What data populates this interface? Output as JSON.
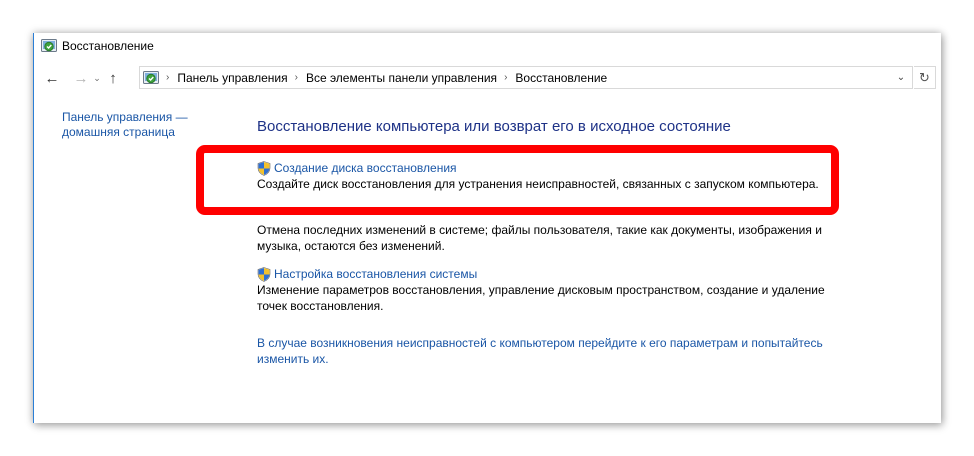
{
  "window": {
    "title": "Восстановление"
  },
  "nav": {
    "back_icon": "←",
    "forward_icon": "→",
    "history_icon": "⌄",
    "up_icon": "↑",
    "refresh_icon": "↻",
    "dropdown_icon": "⌄"
  },
  "breadcrumbs": [
    {
      "label": "Панель управления"
    },
    {
      "label": "Все элементы панели управления"
    },
    {
      "label": "Восстановление"
    }
  ],
  "breadcrumb_separator": "›",
  "sidebar": {
    "home_link_line1": "Панель управления —",
    "home_link_line2": "домашняя страница"
  },
  "main": {
    "heading": "Восстановление компьютера или возврат его в исходное состояние",
    "tasks": [
      {
        "link": "Создание диска восстановления",
        "description": "Создайте диск восстановления для устранения неисправностей, связанных с запуском компьютера.",
        "icon": "shield-icon"
      },
      {
        "link": "",
        "description": "Отмена последних изменений в системе; файлы пользователя, такие как документы, изображения и музыка, остаются без изменений."
      },
      {
        "link": "Настройка восстановления системы",
        "description": "Изменение параметров восстановления, управление дисковым пространством, создание и удаление точек восстановления.",
        "icon": "shield-icon"
      }
    ],
    "footer_link": "В случае возникновения неисправностей с компьютером перейдите к его параметрам и попытайтесь изменить их."
  },
  "colors": {
    "link": "#1a56a6",
    "heading": "#1e3287",
    "highlight": "#ff0000",
    "window_border": "#2b7fd6"
  }
}
